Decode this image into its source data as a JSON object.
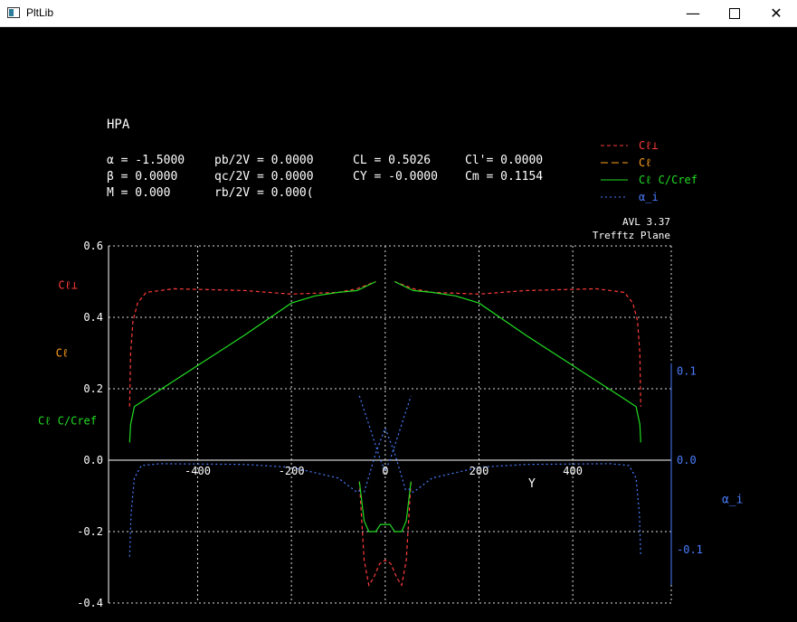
{
  "window": {
    "title": "PltLib",
    "minimize_icon": "minimize-icon",
    "maximize_icon": "maximize-icon",
    "close_icon": "close-icon"
  },
  "header": {
    "case_name": "HPA",
    "params": [
      [
        "α = -1.5000",
        "pb/2V = 0.0000",
        "CL = 0.5026",
        "Cl'= 0.0000"
      ],
      [
        "β = 0.0000",
        "qc/2V = 0.0000",
        "CY = -0.0000",
        "Cm = 0.1154"
      ],
      [
        "M = 0.000",
        "rb/2V = 0.000(",
        "",
        ""
      ]
    ],
    "version": "AVL 3.37",
    "plane": "Trefftz Plane"
  },
  "legend": [
    {
      "label": "Cℓ⊥",
      "color": "#ff3b3b",
      "dash": "4,3"
    },
    {
      "label": "Cℓ",
      "color": "#ff9f1a",
      "dash": "8,4"
    },
    {
      "label": "Cℓ C/Cref",
      "color": "#22dd22",
      "dash": ""
    },
    {
      "label": "α_i",
      "color": "#4a7dff",
      "dash": "2,3"
    }
  ],
  "colors": {
    "grid": "#ffffff",
    "axis": "#ffffff",
    "red": "#ff3b3b",
    "orange": "#ff9f1a",
    "green": "#22dd22",
    "blue": "#4a7dff"
  },
  "chart_data": {
    "type": "line",
    "xlabel": "Y",
    "left_ylabels": [
      "Cℓ⊥",
      "Cℓ",
      "Cℓ C/Cref"
    ],
    "right_ylabel": "α_i",
    "xlim": [
      -590,
      610
    ],
    "ylim": [
      -0.4,
      0.6
    ],
    "right_ylim": [
      -0.4,
      0.6
    ],
    "x_ticks": [
      "-400",
      "-200",
      "0",
      "200",
      "400"
    ],
    "y_ticks": [
      "0.6",
      "0.4",
      "0.2",
      "0.0",
      "-0.2",
      "-0.4"
    ],
    "right_ticks": [
      {
        "v": 0.25,
        "label": "0.1"
      },
      {
        "v": 0.0,
        "label": "0.0"
      },
      {
        "v": -0.25,
        "label": "-0.1"
      }
    ],
    "series": [
      {
        "name": "Cℓ⊥",
        "color": "#ff3b3b",
        "dash": "4,3",
        "segments": [
          [
            [
              -545,
              0.15
            ],
            [
              -543,
              0.3
            ],
            [
              -538,
              0.39
            ],
            [
              -528,
              0.44
            ],
            [
              -510,
              0.47
            ],
            [
              -450,
              0.48
            ],
            [
              -300,
              0.475
            ],
            [
              -200,
              0.465
            ],
            [
              -100,
              0.47
            ],
            [
              -60,
              0.48
            ],
            [
              -20,
              0.5
            ]
          ],
          [
            [
              20,
              0.5
            ],
            [
              60,
              0.48
            ],
            [
              100,
              0.47
            ],
            [
              200,
              0.465
            ],
            [
              300,
              0.475
            ],
            [
              450,
              0.48
            ],
            [
              510,
              0.47
            ],
            [
              528,
              0.44
            ],
            [
              538,
              0.39
            ],
            [
              543,
              0.3
            ],
            [
              545,
              0.15
            ]
          ],
          [
            [
              -55,
              -0.06
            ],
            [
              -45,
              -0.28
            ],
            [
              -35,
              -0.35
            ],
            [
              -25,
              -0.33
            ],
            [
              -12,
              -0.29
            ],
            [
              0,
              -0.28
            ],
            [
              12,
              -0.29
            ],
            [
              25,
              -0.33
            ],
            [
              35,
              -0.35
            ],
            [
              45,
              -0.28
            ],
            [
              55,
              -0.06
            ]
          ]
        ]
      },
      {
        "name": "Cℓ C/Cref",
        "color": "#22dd22",
        "dash": "",
        "segments": [
          [
            [
              -545,
              0.05
            ],
            [
              -543,
              0.1
            ],
            [
              -535,
              0.15
            ],
            [
              -500,
              0.18
            ],
            [
              -400,
              0.265
            ],
            [
              -300,
              0.35
            ],
            [
              -200,
              0.44
            ],
            [
              -150,
              0.46
            ],
            [
              -100,
              0.47
            ],
            [
              -60,
              0.475
            ],
            [
              -20,
              0.5
            ]
          ],
          [
            [
              20,
              0.5
            ],
            [
              60,
              0.475
            ],
            [
              100,
              0.47
            ],
            [
              150,
              0.46
            ],
            [
              200,
              0.44
            ],
            [
              300,
              0.35
            ],
            [
              400,
              0.265
            ],
            [
              500,
              0.18
            ],
            [
              535,
              0.15
            ],
            [
              543,
              0.1
            ],
            [
              545,
              0.05
            ]
          ],
          [
            [
              -55,
              -0.06
            ],
            [
              -45,
              -0.17
            ],
            [
              -35,
              -0.2
            ],
            [
              -20,
              -0.2
            ],
            [
              -10,
              -0.18
            ],
            [
              0,
              -0.18
            ],
            [
              10,
              -0.18
            ],
            [
              20,
              -0.2
            ],
            [
              35,
              -0.2
            ],
            [
              45,
              -0.17
            ],
            [
              55,
              -0.06
            ]
          ]
        ]
      },
      {
        "name": "α_i",
        "color": "#4a7dff",
        "dash": "2,3",
        "segments": [
          [
            [
              -545,
              -0.27
            ],
            [
              -542,
              -0.15
            ],
            [
              -535,
              -0.05
            ],
            [
              -520,
              -0.015
            ],
            [
              -480,
              -0.01
            ],
            [
              -300,
              -0.012
            ],
            [
              -200,
              -0.02
            ],
            [
              -100,
              -0.05
            ],
            [
              -60,
              -0.09
            ],
            [
              -50,
              -0.08
            ]
          ],
          [
            [
              50,
              -0.08
            ],
            [
              60,
              -0.09
            ],
            [
              100,
              -0.05
            ],
            [
              200,
              -0.02
            ],
            [
              300,
              -0.012
            ],
            [
              480,
              -0.01
            ],
            [
              520,
              -0.015
            ],
            [
              535,
              -0.05
            ],
            [
              542,
              -0.15
            ],
            [
              545,
              -0.27
            ]
          ],
          [
            [
              -55,
              0.18
            ],
            [
              -30,
              0.08
            ],
            [
              -10,
              0.0
            ],
            [
              0,
              -0.03
            ],
            [
              10,
              0.0
            ],
            [
              30,
              0.08
            ],
            [
              55,
              0.18
            ]
          ],
          [
            [
              -45,
              -0.09
            ],
            [
              -20,
              0.02
            ],
            [
              0,
              0.09
            ],
            [
              20,
              0.02
            ],
            [
              45,
              -0.09
            ]
          ]
        ]
      }
    ]
  }
}
